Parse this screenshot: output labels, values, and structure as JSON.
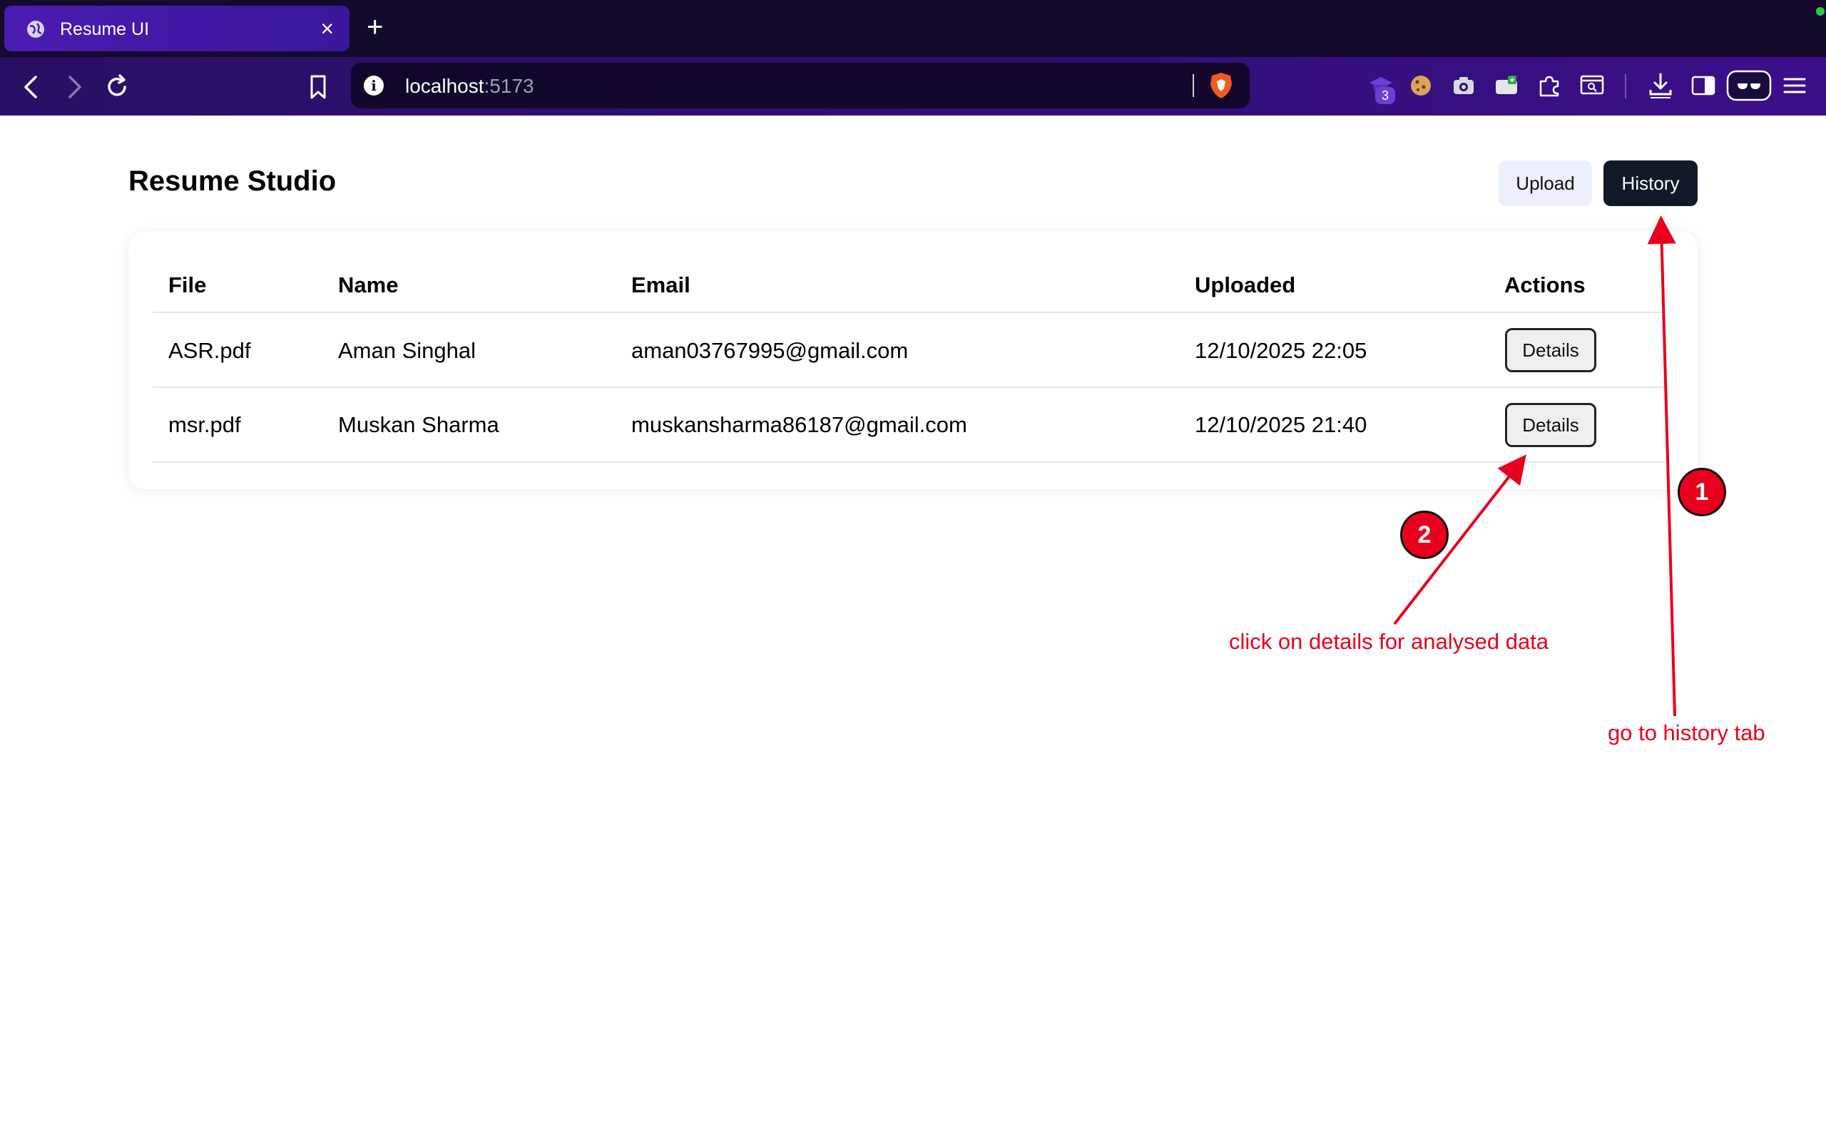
{
  "browser": {
    "tab_title": "Resume UI",
    "url_host": "localhost",
    "url_port": ":5173",
    "extension_badge": "3",
    "theme_color": "#2f0f74"
  },
  "header": {
    "title": "Resume Studio",
    "upload_label": "Upload",
    "history_label": "History"
  },
  "table": {
    "columns": [
      "File",
      "Name",
      "Email",
      "Uploaded",
      "Actions"
    ],
    "rows": [
      {
        "file": "ASR.pdf",
        "name": "Aman Singhal",
        "email": "aman03767995@gmail.com",
        "uploaded": "12/10/2025 22:05",
        "action": "Details"
      },
      {
        "file": "msr.pdf",
        "name": "Muskan Sharma",
        "email": "muskansharma86187@gmail.com",
        "uploaded": "12/10/2025 21:40",
        "action": "Details"
      }
    ]
  },
  "annotations": {
    "step1_number": "1",
    "step1_text": "go to history tab",
    "step2_number": "2",
    "step2_text": "click on details for analysed data",
    "color": "#e8001c"
  }
}
